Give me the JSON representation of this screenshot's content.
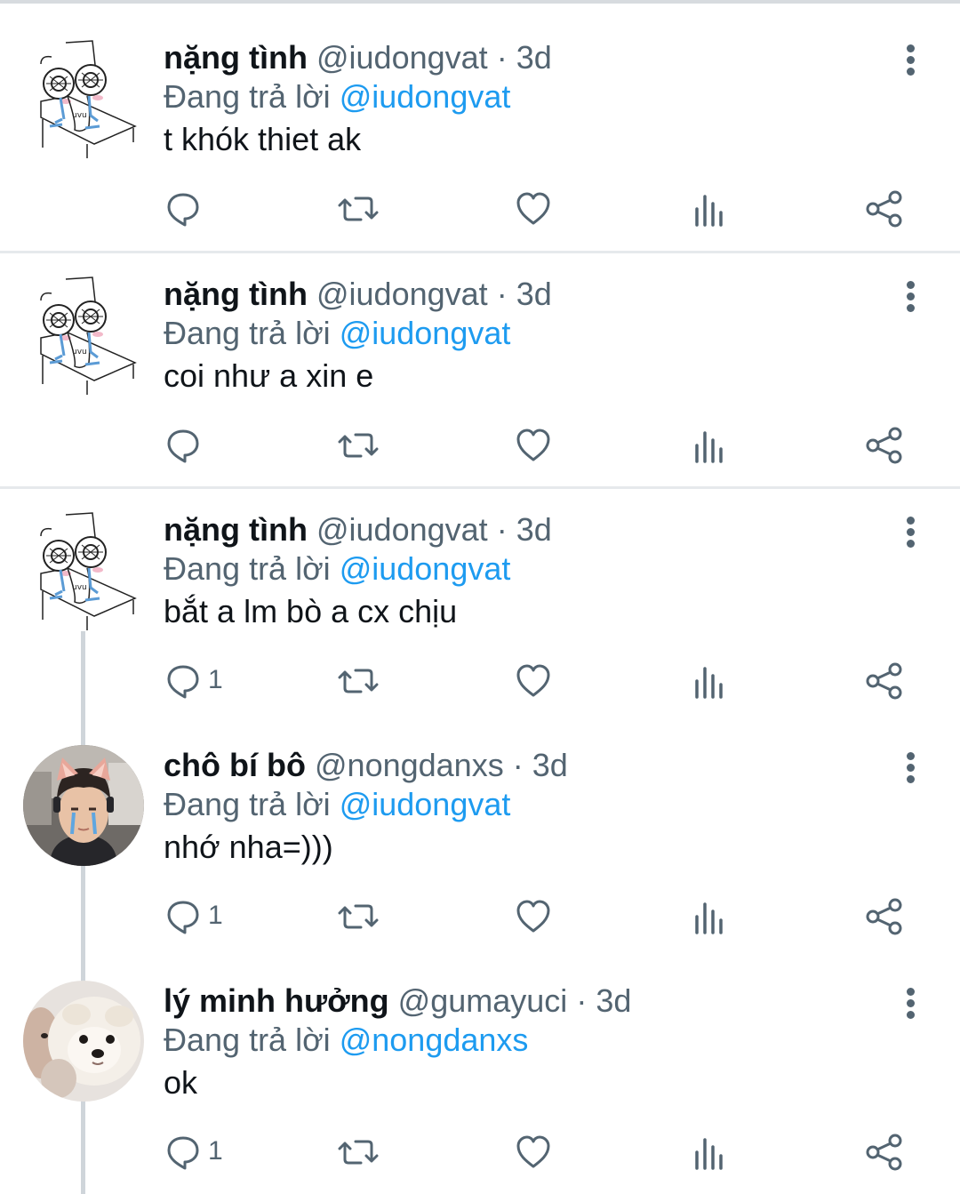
{
  "tweets": [
    {
      "name": "nặng tình",
      "handle": "@iudongvat",
      "separator": "·",
      "time": "3d",
      "reply_prefix": "Đang trả lời",
      "reply_to": "@iudongvat",
      "text": "t khók thiet ak",
      "reply_count": "",
      "avatar": "sketch-crying-character"
    },
    {
      "name": "nặng tình",
      "handle": "@iudongvat",
      "separator": "·",
      "time": "3d",
      "reply_prefix": "Đang trả lời",
      "reply_to": "@iudongvat",
      "text": "coi như a xin e",
      "reply_count": "",
      "avatar": "sketch-crying-character"
    },
    {
      "name": "nặng tình",
      "handle": "@iudongvat",
      "separator": "·",
      "time": "3d",
      "reply_prefix": "Đang trả lời",
      "reply_to": "@iudongvat",
      "text": "bắt a lm bò a cx chịu",
      "reply_count": "1",
      "avatar": "sketch-crying-character"
    },
    {
      "name": "chô bí bô",
      "handle": "@nongdanxs",
      "separator": "·",
      "time": "3d",
      "reply_prefix": "Đang trả lời",
      "reply_to": "@iudongvat",
      "text": "nhớ nha=)))",
      "reply_count": "1",
      "avatar": "photo-person-with-cat-ears"
    },
    {
      "name": "lý minh hưởng",
      "handle": "@gumayuci",
      "separator": "·",
      "time": "3d",
      "reply_prefix": "Đang trả lời",
      "reply_to": "@nongdanxs",
      "text": "ok",
      "reply_count": "1",
      "avatar": "photo-fluffy-white-dog"
    }
  ],
  "icons": [
    "reply-icon",
    "retweet-icon",
    "like-icon",
    "analytics-icon",
    "share-icon",
    "more-icon"
  ],
  "colors": {
    "mention": "#1d9bf0",
    "secondary_text": "#536471",
    "primary_text": "#0f1419",
    "thread_line": "#cfd5da"
  }
}
